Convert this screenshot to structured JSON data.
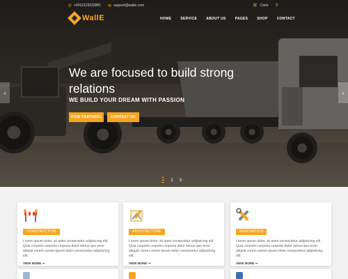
{
  "topbar": {
    "phone": "+0012123232881",
    "email": "support@walle.com",
    "cart": "Carts",
    "phone_icon": "phone-icon",
    "email_icon": "mail-icon",
    "cart_icon": "cart-icon",
    "search_icon": "search-icon"
  },
  "brand": {
    "name": "WallE",
    "color": "#f5a623"
  },
  "nav": {
    "items": [
      "HOME",
      "SERVICE",
      "ABOUT US",
      "PAGES",
      "SHOP",
      "CONTACT"
    ]
  },
  "hero": {
    "title": "We are focused to build strong relations",
    "subtitle": "WE BUILD YOUR DREAM WITH PASSION",
    "buttons": [
      "VIEW FEATURES",
      "CONTACT US"
    ],
    "pages": [
      "1",
      "2",
      "3"
    ],
    "active_page": "1",
    "prev_icon": "chevron-left-icon",
    "next_icon": "chevron-right-icon"
  },
  "services": {
    "cards": [
      {
        "icon": "barrier-icon",
        "tag": "CONSTRUCTION",
        "text": "Lorem ipsum dolor, sit amet consectetur adipisicing elit. Quia corporis corporis corporis dolor minus quo error aliquid corem corem ipsum dolor consectetur adipisicing elit.",
        "more": "VIEW MORE ➞"
      },
      {
        "icon": "blueprint-icon",
        "tag": "ARCHITECTURE",
        "text": "Lorem ipsum dolor, sit amet consectetur adipisicing elit. Quia corporis corporis corporis dolor minus quo error aliquid corem corem ipsum dolor consectetur adipisicing elit.",
        "more": "VIEW MORE ➞"
      },
      {
        "icon": "tools-icon",
        "tag": "RENOVATION",
        "text": "Lorem ipsum dolor, sit amet consectetur adipisicing elit. Quia corporis corporis corporis dolor minus quo error aliquid corem corem ipsum dolor consectetur adipisicing elit.",
        "more": "VIEW MORE ➞"
      }
    ]
  }
}
